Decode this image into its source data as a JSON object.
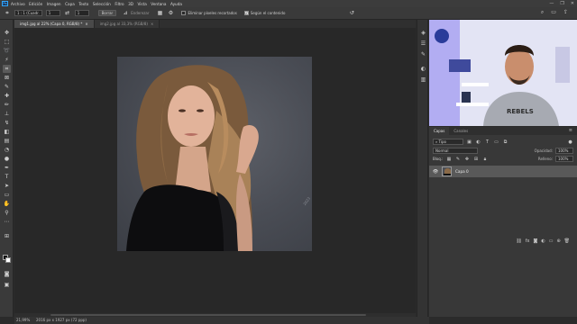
{
  "menubar": {
    "logo": "Ps",
    "items": [
      "Archivo",
      "Edición",
      "Imagen",
      "Capa",
      "Texto",
      "Selección",
      "Filtro",
      "3D",
      "Vista",
      "Ventana",
      "Ayuda"
    ],
    "window_controls": [
      "—",
      "❐",
      "✕"
    ]
  },
  "options": {
    "ratio": "1 : 1 (Cuadr.",
    "w": "1",
    "h": "1",
    "clear_label": "Borrar",
    "straighten_label": "Enderezar",
    "delete_cropped_label": "Eliminar píxeles recortados",
    "content_aware_label": "Según el contenido"
  },
  "tabs": [
    {
      "label": "img1.jpg al 22% (Capa 0, RGB/8) *",
      "close": "×"
    },
    {
      "label": "img2.jpg al 33,3% (RGB/8)",
      "close": "×"
    }
  ],
  "canvas": {
    "watermark": "2023"
  },
  "layers_panel": {
    "tabs": [
      "Capas",
      "Canales"
    ],
    "filter": "Tipo",
    "blend_mode": "Normal",
    "opacity_label": "Opacidad:",
    "opacity_value": "100%",
    "lock_label": "Bloq.:",
    "fill_label": "Relleno:",
    "fill_value": "100%",
    "layer_name": "Capa 0"
  },
  "status": {
    "zoom": "21,99%",
    "doc_size": "2016 px x 1927 px (72 ppp)"
  },
  "colors": {
    "accent": "#31a8ff",
    "panel_bg": "#383838",
    "canvas_bg": "#282828"
  }
}
